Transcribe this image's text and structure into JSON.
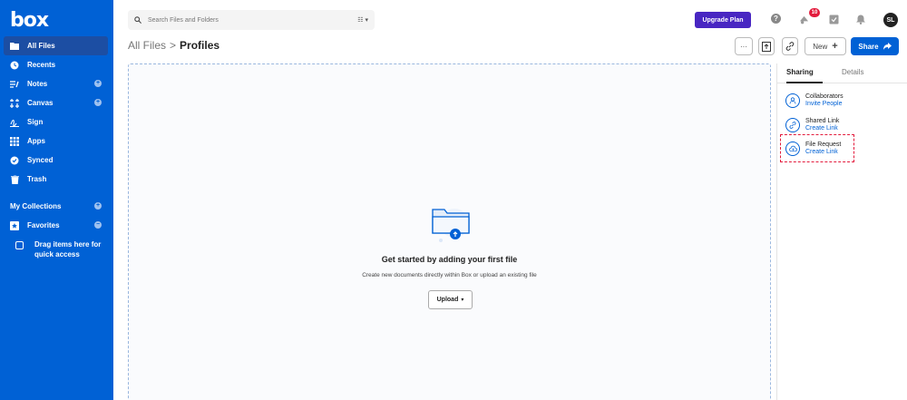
{
  "brand": {
    "logo": "box"
  },
  "sidebar": {
    "items": [
      {
        "label": "All Files",
        "icon": "folder-icon",
        "active": true
      },
      {
        "label": "Recents",
        "icon": "clock-icon"
      },
      {
        "label": "Notes",
        "icon": "notes-icon",
        "has_add": true
      },
      {
        "label": "Canvas",
        "icon": "canvas-icon",
        "has_add": true
      },
      {
        "label": "Sign",
        "icon": "sign-icon"
      },
      {
        "label": "Apps",
        "icon": "apps-icon"
      },
      {
        "label": "Synced",
        "icon": "check-circle-icon"
      },
      {
        "label": "Trash",
        "icon": "trash-icon"
      }
    ],
    "collections_label": "My Collections",
    "favorites_label": "Favorites",
    "drag_hint": "Drag items here for quick access"
  },
  "topbar": {
    "search_placeholder": "Search Files and Folders",
    "upgrade_label": "Upgrade Plan",
    "notification_count": "10",
    "avatar_initials": "SL"
  },
  "breadcrumb": {
    "root": "All Files",
    "separator": ">",
    "current": "Profiles"
  },
  "toolbar": {
    "more_label": "···",
    "new_label": "New",
    "share_label": "Share"
  },
  "empty_state": {
    "title": "Get started by adding your first file",
    "subtitle": "Create new documents directly within Box or upload an existing file",
    "upload_label": "Upload"
  },
  "right_panel": {
    "tabs": [
      "Sharing",
      "Details"
    ],
    "items": [
      {
        "title": "Collaborators",
        "action": "Invite People",
        "icon": "person-icon"
      },
      {
        "title": "Shared Link",
        "action": "Create Link",
        "icon": "link-icon"
      },
      {
        "title": "File Request",
        "action": "Create Link",
        "icon": "upload-cloud-icon"
      }
    ]
  },
  "colors": {
    "brand": "#0061d5",
    "upgrade": "#4826c2",
    "badge": "#e31c3d",
    "highlight": "#e31c3d"
  }
}
